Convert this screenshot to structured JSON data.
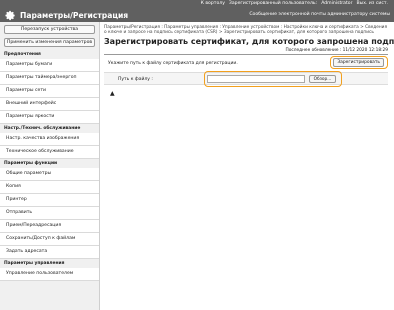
{
  "header": {
    "title": "Параметры/Регистрация",
    "links": [
      "К вортолу",
      "Зарегистрированный пользователь:",
      "Administrator",
      "Вых. из сист."
    ],
    "message": "Сообщение электронной почты администратору системы"
  },
  "sidebar": {
    "device_button": "Перезапуск устройства",
    "apply_button": "Применить изменения параметров",
    "sections": [
      {
        "title": "Предпочтения",
        "items": [
          "Параметры бумаги",
          "Параметры таймера/энергоп",
          "Параметры сети",
          "Внешний интерфейс",
          "Параметры яркости"
        ]
      },
      {
        "title": "Настр./Технич. обслуживание",
        "items": [
          "Настр. качества изображения",
          "Техническое обслуживание"
        ]
      },
      {
        "title": "Параметры функции",
        "items": [
          "Общие параметры",
          "Копия",
          "Принтер",
          "Отправить",
          "Прием/Переадресация",
          "Сохранить/Доступ к файлам"
        ]
      },
      {
        "title": "",
        "items": [
          "Задать адресата"
        ]
      },
      {
        "title": "Параметры управления",
        "items": [
          "Управление пользователем"
        ]
      }
    ]
  },
  "main": {
    "breadcrumb": "Параметры/Регистрация : Параметры управления : Управление устройством : Настройки ключа и сертификата > Сведения о ключе и запросе на подпись сертификата (CSR) > Зарегистрировать сертификат, для которого запрошена подпись",
    "title": "Зарегистрировать сертификат, для которого запрошена подпись",
    "last_update": "Последнее обновление : 11/12 2020 12:18:29",
    "instruction": "Укажите путь к файлу сертификата для регистрации.",
    "register_button": "Зарегистрировать",
    "file_label": "Путь к файлу :",
    "file_value": "",
    "browse_button": "Обзор...",
    "top_arrow": "▲"
  },
  "colors": {
    "topbar": "#606060",
    "highlight": "#f2a01e",
    "sidebar_bg": "#f0f0f0"
  }
}
